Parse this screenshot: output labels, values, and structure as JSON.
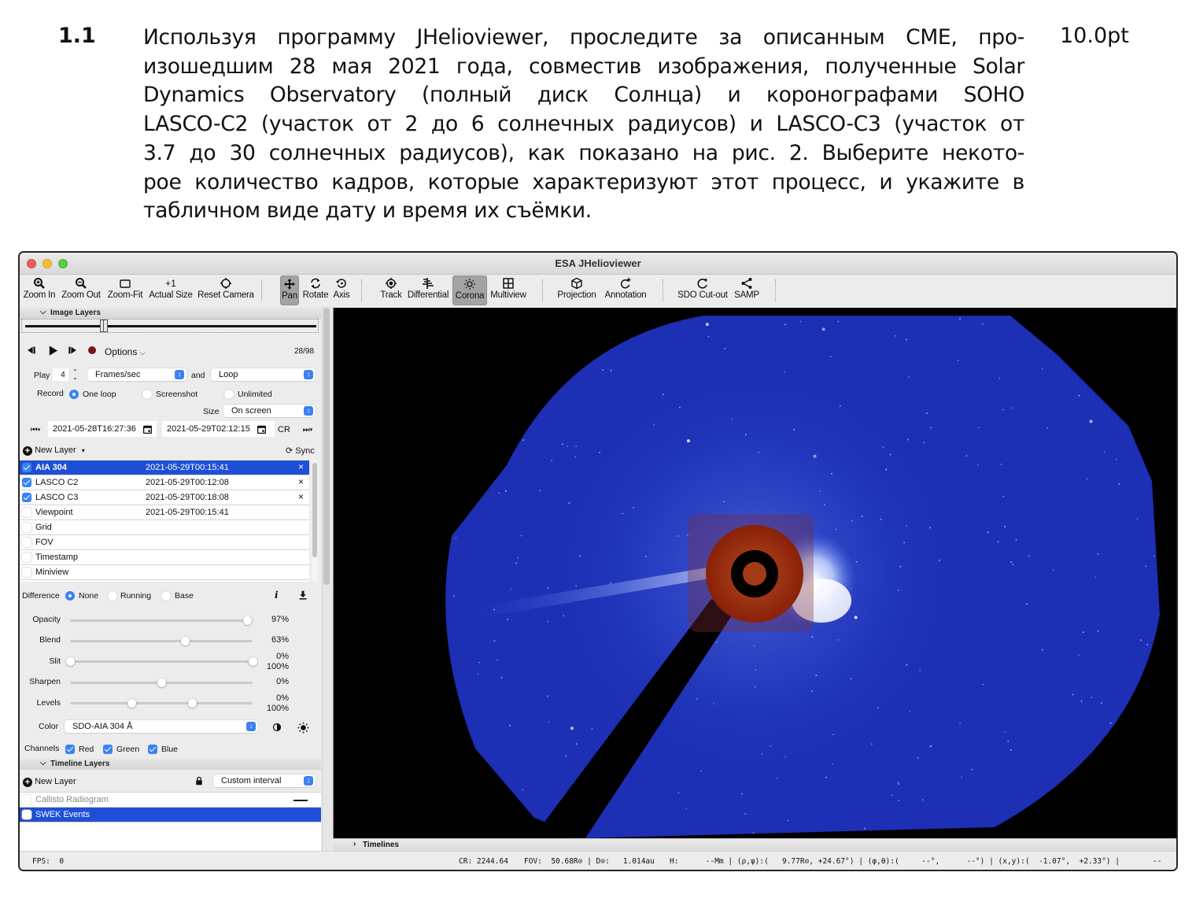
{
  "document": {
    "item_number": "1.1",
    "points": "10.0pt",
    "lines": [
      "Используя программу JHelioviewer, проследите за описанным CME, про-",
      "изошедшим 28 мая 2021 года, совместив изображения, полученные Solar",
      "Dynamics Observatory (полный диск Солнца) и коронографами SOHO",
      "LASCO-C2 (участок от 2 до 6 солнечных радиусов) и LASCO-C3 (участок от",
      "3.7 до 30 солнечных радиусов), как показано на рис. 2. Выберите некото-",
      "рое количество кадров, которые характеризуют этот процесс, и укажите в",
      "табличном виде дату и время их съёмки."
    ]
  },
  "window": {
    "title": "ESA JHelioviewer"
  },
  "toolbar": {
    "zoom_in": {
      "label": "Zoom In",
      "icon": "zoom-in-icon"
    },
    "zoom_out": {
      "label": "Zoom Out",
      "icon": "zoom-out-icon"
    },
    "zoom_fit": {
      "label": "Zoom-Fit",
      "icon": "zoom-fit-icon"
    },
    "actual_size": {
      "label": "Actual Size",
      "icon": "+1"
    },
    "reset_camera": {
      "label": "Reset Camera",
      "icon": "reset-camera-icon"
    },
    "pan": {
      "label": "Pan",
      "icon": "pan-icon",
      "active": true
    },
    "rotate": {
      "label": "Rotate",
      "icon": "rotate-icon"
    },
    "axis": {
      "label": "Axis",
      "icon": "axis-icon"
    },
    "track": {
      "label": "Track",
      "icon": "track-icon"
    },
    "differential": {
      "label": "Differential",
      "icon": "differential-icon"
    },
    "corona": {
      "label": "Corona",
      "icon": "corona-icon",
      "active": true
    },
    "multiview": {
      "label": "Multiview",
      "icon": "multiview-icon"
    },
    "projection": {
      "label": "Projection",
      "icon": "projection-icon"
    },
    "annotation": {
      "label": "Annotation",
      "icon": "annotation-icon"
    },
    "sdo_cutout": {
      "label": "SDO Cut-out",
      "icon": "sdo-cutout-icon"
    },
    "samp": {
      "label": "SAMP",
      "icon": "share-icon"
    }
  },
  "image_layers": {
    "section_title": "Image Layers",
    "frame_position": 0.27,
    "frame_counter": "28/98",
    "options_label": "Options",
    "play_label": "Play",
    "play_value": "4",
    "speed_unit": "Frames/sec",
    "and_label": "and",
    "loop_mode": "Loop",
    "record_label": "Record",
    "record_options": [
      "One loop",
      "Screenshot",
      "Unlimited"
    ],
    "record_selected": "One loop",
    "size_label": "Size",
    "size_value": "On screen",
    "start_time": "2021-05-28T16:27:36",
    "end_time": "2021-05-29T02:12:15",
    "cr_label": "CR",
    "new_layer_label": "New Layer",
    "sync_label": "Sync",
    "layers": [
      {
        "name": "AIA 304",
        "date": "2021-05-29T00:15:41",
        "checked": true,
        "selected": true,
        "removable": true
      },
      {
        "name": "LASCO C2",
        "date": "2021-05-29T00:12:08",
        "checked": true,
        "selected": false,
        "removable": true
      },
      {
        "name": "LASCO C3",
        "date": "2021-05-29T00:18:08",
        "checked": true,
        "selected": false,
        "removable": true
      },
      {
        "name": "Viewpoint",
        "date": "2021-05-29T00:15:41",
        "checked": false,
        "selected": false,
        "removable": false
      },
      {
        "name": "Grid",
        "date": "",
        "checked": false,
        "selected": false,
        "removable": false
      },
      {
        "name": "FOV",
        "date": "",
        "checked": false,
        "selected": false,
        "removable": false
      },
      {
        "name": "Timestamp",
        "date": "",
        "checked": false,
        "selected": false,
        "removable": false
      },
      {
        "name": "Miniview",
        "date": "",
        "checked": false,
        "selected": false,
        "removable": false
      }
    ],
    "remove_glyph": "×"
  },
  "adjustments": {
    "difference_label": "Difference",
    "difference_options": [
      "None",
      "Running",
      "Base"
    ],
    "difference_selected": "None",
    "info_glyph": "i",
    "opacity": {
      "label": "Opacity",
      "value": 0.97,
      "text": "97%"
    },
    "blend": {
      "label": "Blend",
      "value": 0.63,
      "text": "63%"
    },
    "slit": {
      "label": "Slit",
      "low": 0.0,
      "high": 1.0,
      "text_low": "0%",
      "text_high": "100%"
    },
    "sharpen": {
      "label": "Sharpen",
      "value": 0.5,
      "text": "0%"
    },
    "levels": {
      "label": "Levels",
      "low": 0.34,
      "high": 0.67,
      "text_low": "0%",
      "text_high": "100%"
    },
    "color_label": "Color",
    "color_value": "SDO-AIA 304 Å",
    "channels_label": "Channels",
    "channels": [
      {
        "name": "Red",
        "checked": true
      },
      {
        "name": "Green",
        "checked": true
      },
      {
        "name": "Blue",
        "checked": true
      }
    ]
  },
  "timeline_layers": {
    "section_title": "Timeline Layers",
    "new_layer_label": "New Layer",
    "interval": "Custom interval",
    "layers": [
      {
        "name": "Callisto Radiogram",
        "checked": false,
        "selected": false,
        "disabled": true
      },
      {
        "name": "SWEK Events",
        "checked": false,
        "selected": true,
        "disabled": false
      }
    ]
  },
  "viewer": {
    "timelines_label": "Timelines",
    "colors": {
      "coronagraph": "#1a2fb8",
      "aia": "#7a1a08",
      "background": "#000000"
    }
  },
  "status": {
    "fps": "FPS:  0",
    "cr": "CR: 2244.64",
    "fov": "FOV:  50.68R⊙ | D⊙:   1.014au",
    "h": "H:      --Mm | (ρ,ψ):(   9.77R⊙, +24.67°) | (φ,θ):(     --°,      --°) | (x,y):(  -1.07°,  +2.33°) |",
    "tail": "--"
  }
}
